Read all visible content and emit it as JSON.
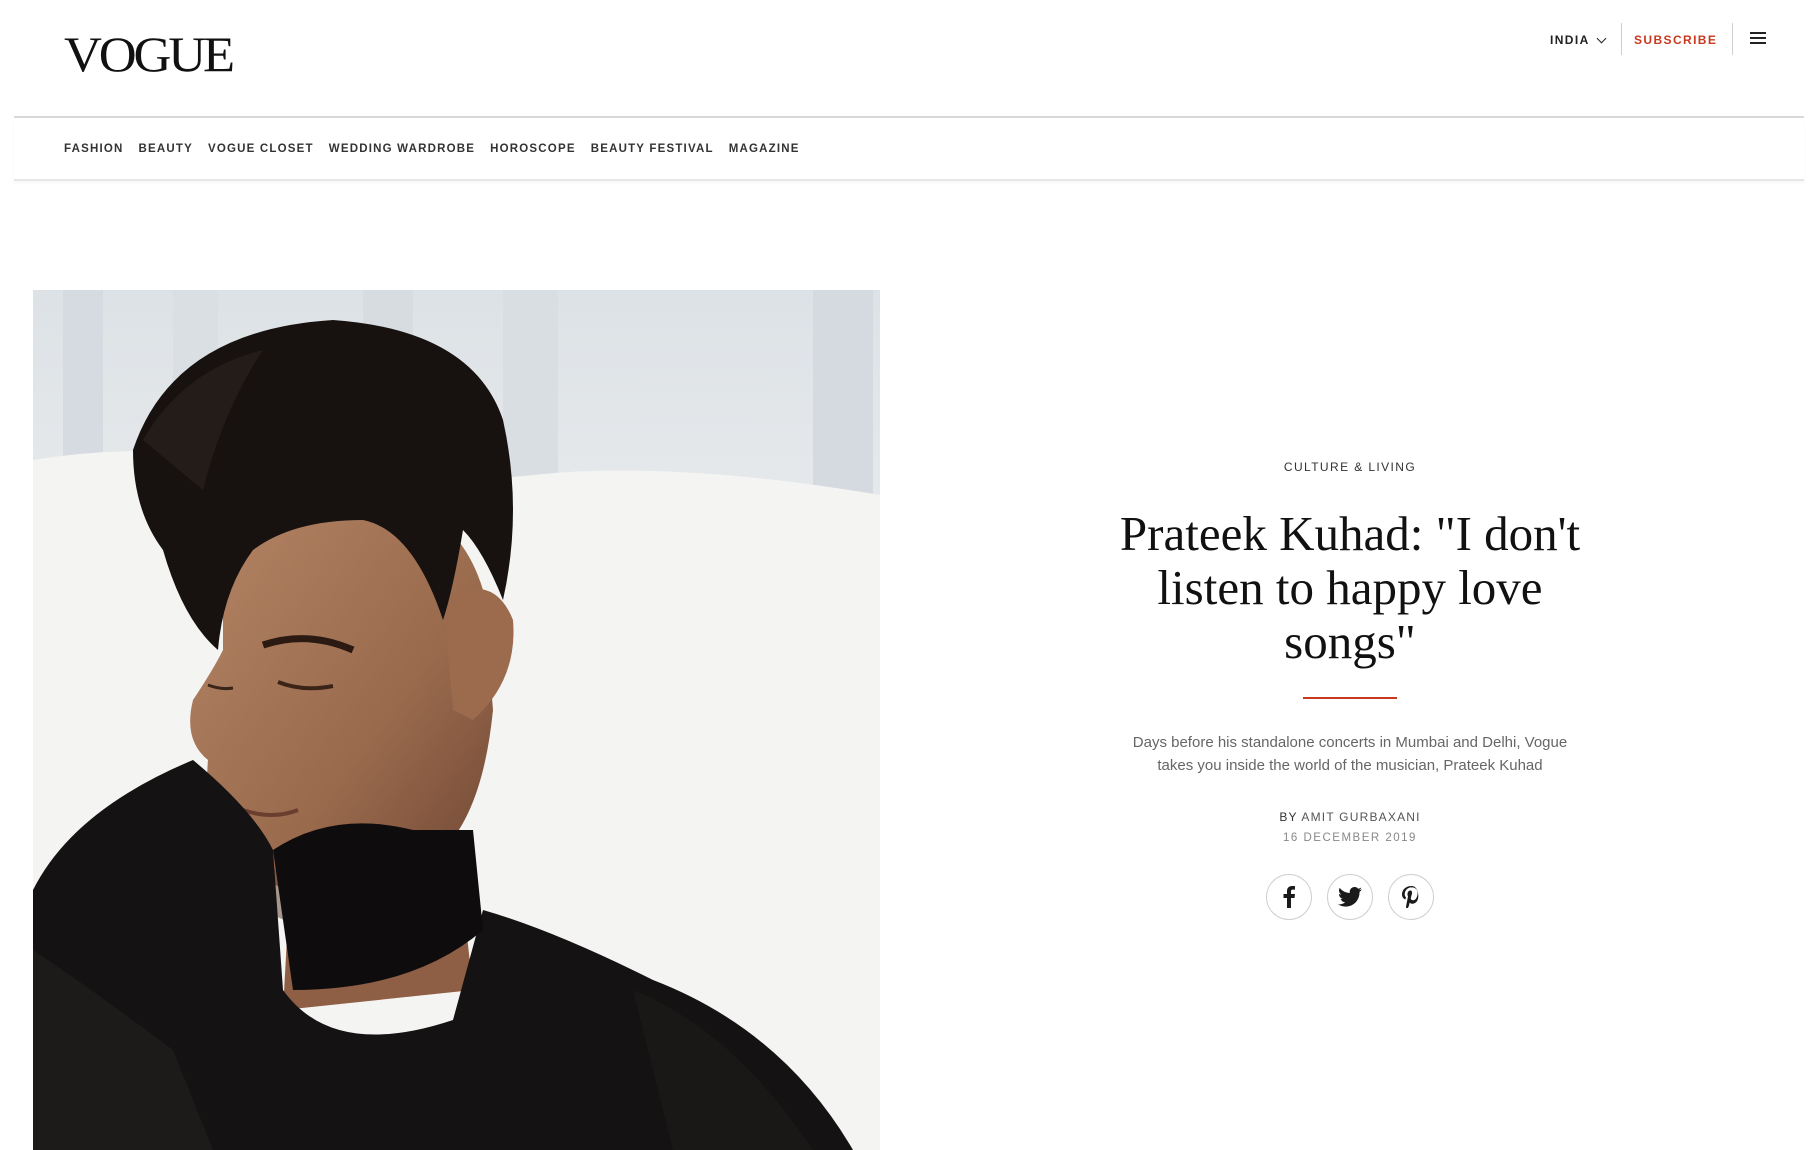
{
  "header": {
    "logo": "VOGUE",
    "edition": "INDIA",
    "subscribe": "SUBSCRIBE",
    "menu_icon": "hamburger-menu-icon"
  },
  "nav": {
    "items": [
      {
        "label": "FASHION"
      },
      {
        "label": "BEAUTY"
      },
      {
        "label": "VOGUE CLOSET"
      },
      {
        "label": "WEDDING WARDROBE"
      },
      {
        "label": "HOROSCOPE"
      },
      {
        "label": "BEAUTY FESTIVAL"
      },
      {
        "label": "MAGAZINE"
      }
    ]
  },
  "article": {
    "category": "CULTURE & LIVING",
    "headline": "Prateek Kuhad: \"I don't listen to happy love songs\"",
    "dek": "Days before his standalone concerts in Mumbai and Delhi, Vogue takes you inside the world of the musician, Prateek Kuhad",
    "byline_prefix": "BY",
    "author": "AMIT GURBAXANI",
    "date": "16 DECEMBER 2019",
    "share": [
      {
        "icon": "facebook-icon"
      },
      {
        "icon": "twitter-icon"
      },
      {
        "icon": "pinterest-icon"
      }
    ]
  },
  "colors": {
    "accent": "#c8391e",
    "text": "#111111",
    "muted": "#666666"
  }
}
